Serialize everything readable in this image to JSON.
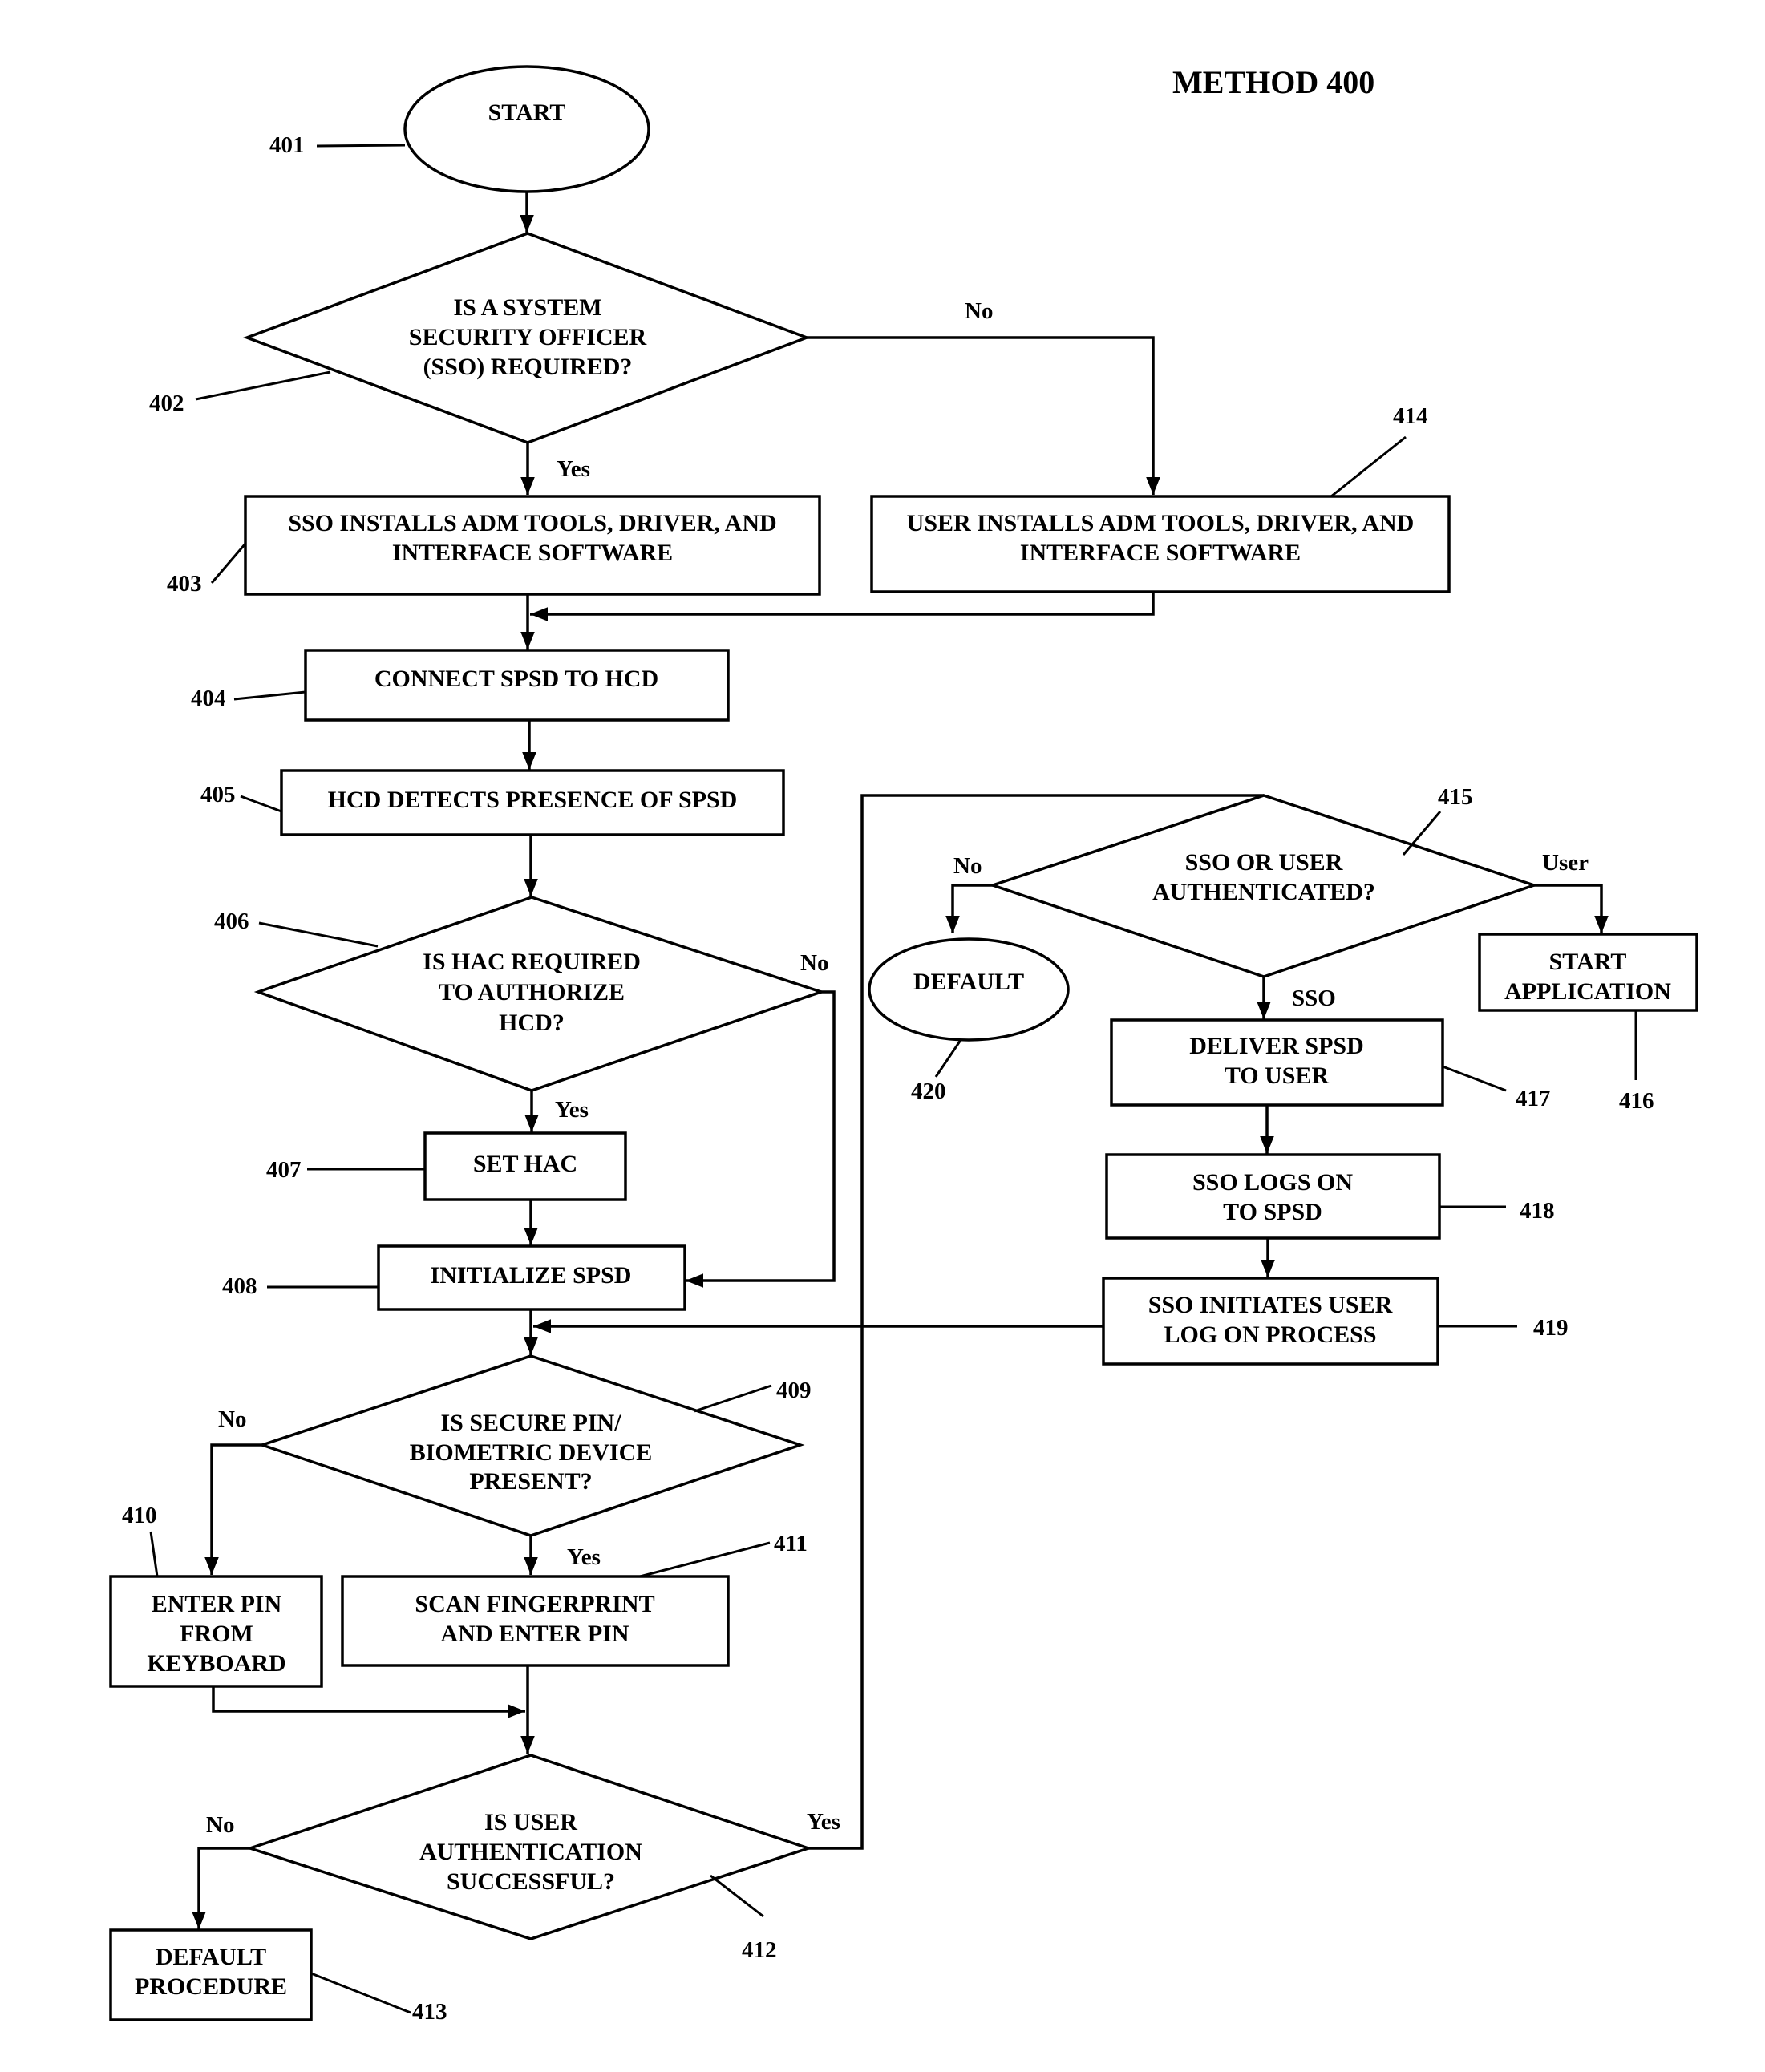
{
  "title": "METHOD 400",
  "nodes": {
    "n401": {
      "ref": "401",
      "lines": [
        "START"
      ]
    },
    "n402": {
      "ref": "402",
      "lines": [
        "IS A SYSTEM",
        "SECURITY OFFICER",
        "(SSO)  REQUIRED?"
      ]
    },
    "n403": {
      "ref": "403",
      "lines": [
        "SSO INSTALLS ADM TOOLS, DRIVER, AND",
        "INTERFACE SOFTWARE"
      ]
    },
    "n404": {
      "ref": "404",
      "lines": [
        "CONNECT SPSD TO HCD"
      ]
    },
    "n405": {
      "ref": "405",
      "lines": [
        "HCD DETECTS PRESENCE OF SPSD"
      ]
    },
    "n406": {
      "ref": "406",
      "lines": [
        "IS HAC REQUIRED",
        "TO AUTHORIZE",
        "HCD?"
      ]
    },
    "n407": {
      "ref": "407",
      "lines": [
        "SET HAC"
      ]
    },
    "n408": {
      "ref": "408",
      "lines": [
        "INITIALIZE SPSD"
      ]
    },
    "n409": {
      "ref": "409",
      "lines": [
        "IS SECURE PIN/",
        "BIOMETRIC DEVICE",
        "PRESENT?"
      ]
    },
    "n410": {
      "ref": "410",
      "lines": [
        "ENTER PIN",
        "FROM",
        "KEYBOARD"
      ]
    },
    "n411": {
      "ref": "411",
      "lines": [
        "SCAN FINGERPRINT",
        "AND ENTER PIN"
      ]
    },
    "n412": {
      "ref": "412",
      "lines": [
        "IS USER",
        "AUTHENTICATION",
        "SUCCESSFUL?"
      ]
    },
    "n413": {
      "ref": "413",
      "lines": [
        "DEFAULT",
        "PROCEDURE"
      ]
    },
    "n414": {
      "ref": "414",
      "lines": [
        "USER INSTALLS ADM TOOLS, DRIVER, AND",
        "INTERFACE SOFTWARE"
      ]
    },
    "n415": {
      "ref": "415",
      "lines": [
        "SSO OR USER",
        "AUTHENTICATED?"
      ]
    },
    "n416": {
      "ref": "416",
      "lines": [
        "START",
        "APPLICATION"
      ]
    },
    "n417": {
      "ref": "417",
      "lines": [
        "DELIVER SPSD",
        "TO USER"
      ]
    },
    "n418": {
      "ref": "418",
      "lines": [
        "SSO LOGS ON",
        "TO SPSD"
      ]
    },
    "n419": {
      "ref": "419",
      "lines": [
        "SSO INITIATES USER",
        "LOG ON PROCESS"
      ]
    },
    "n420": {
      "ref": "420",
      "lines": [
        "DEFAULT"
      ]
    }
  },
  "edge_labels": {
    "e402_no": "No",
    "e402_yes": "Yes",
    "e406_no": "No",
    "e406_yes": "Yes",
    "e409_no": "No",
    "e409_yes": "Yes",
    "e412_no": "No",
    "e412_yes": "Yes",
    "e415_no": "No",
    "e415_user": "User",
    "e415_sso": "SSO"
  }
}
